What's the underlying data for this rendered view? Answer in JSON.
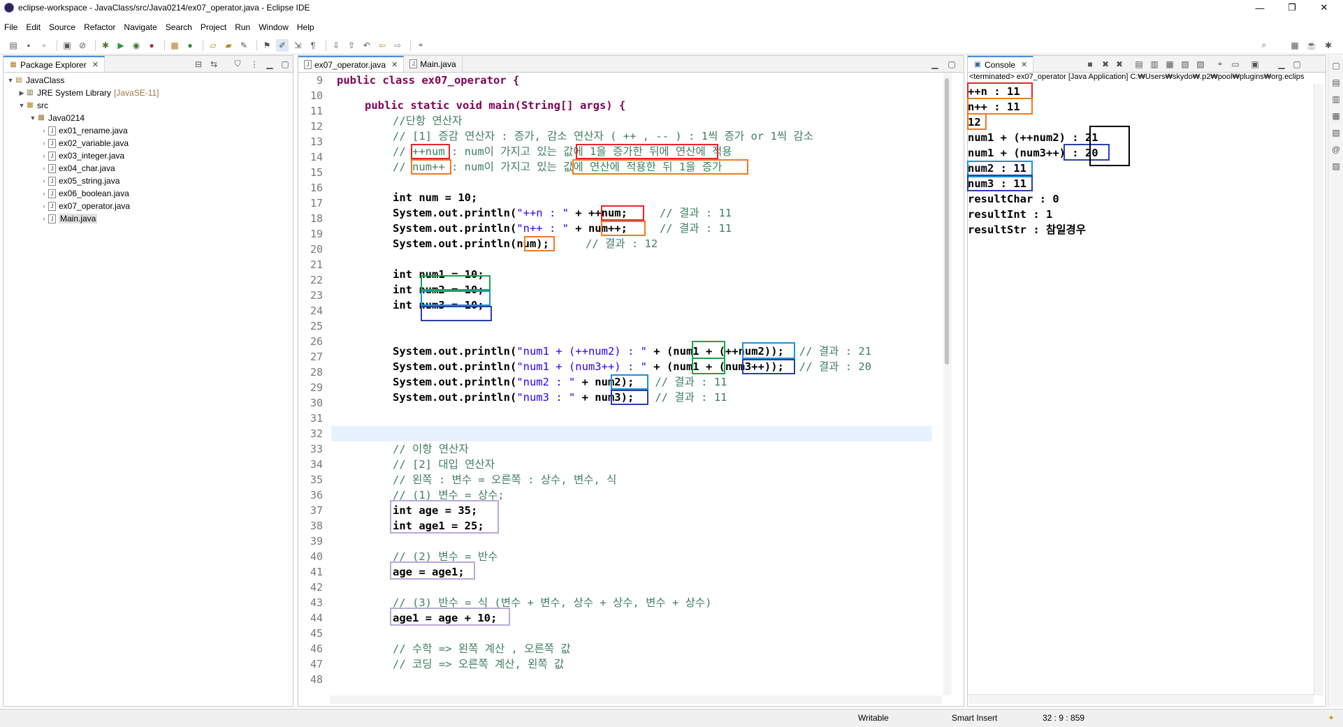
{
  "window": {
    "title": "eclipse-workspace - JavaClass/src/Java0214/ex07_operator.java - Eclipse IDE",
    "minimize": "—",
    "maximize": "❐",
    "close": "✕"
  },
  "menu": [
    "File",
    "Edit",
    "Source",
    "Refactor",
    "Navigate",
    "Search",
    "Project",
    "Run",
    "Window",
    "Help"
  ],
  "package_explorer": {
    "tab": "Package Explorer",
    "nodes": {
      "project": "JavaClass",
      "jre": "JRE System Library",
      "jre_version": "[JavaSE-11]",
      "src": "src",
      "package": "Java0214"
    },
    "files": [
      "ex01_rename.java",
      "ex02_variable.java",
      "ex03_integer.java",
      "ex04_char.java",
      "ex05_string.java",
      "ex06_boolean.java",
      "ex07_operator.java",
      "Main.java"
    ]
  },
  "editor": {
    "tabs": [
      "ex07_operator.java",
      "Main.java"
    ],
    "line_numbers": [
      "9",
      "10",
      "11",
      "12",
      "13",
      "14",
      "15",
      "16",
      "17",
      "18",
      "19",
      "20",
      "21",
      "22",
      "23",
      "24",
      "25",
      "26",
      "27",
      "28",
      "29",
      "30",
      "31",
      "32",
      "33",
      "34",
      "35",
      "36",
      "37",
      "38",
      "39",
      "40",
      "41",
      "42",
      "43",
      "44",
      "45",
      "46",
      "47",
      "48"
    ],
    "lines": {
      "l9": "public class ex07_operator {",
      "l11": "public static void main(String[] args) {",
      "l12": "//단항 연산자",
      "l13": "// [1] 증감 연산자 : 증가, 감소 연산자 ( ++ , -- ) : 1씩 증가 or 1씩 감소",
      "l14": "// ++num : num이 가지고 있는 값에 1을 증가한 뒤에 연산에 적용",
      "l15": "// num++ : num이 가지고 있는 값에 연산에 적용한 뒤 1을 증가",
      "l17": "int num = 10;",
      "l18a": "System.out.println(",
      "l18s": "\"++n : \"",
      "l18b": " + ++num;",
      "l18c": "// 결과 : 11",
      "l19s": "\"n++ : \"",
      "l19b": " + num++;",
      "l19c": "// 결과 : 11",
      "l20b": "num);",
      "l20c": "// 결과 : 12",
      "l22": "int num1 = 10;",
      "l23": "int num2 = 10;",
      "l24": "int num3 = 10;",
      "l27s": "\"num1 + (++num2) : \"",
      "l27b": " + (num1 + (++num2));",
      "l27c": "// 결과 : 21",
      "l28s": "\"num1 + (num3++) : \"",
      "l28b": " + (num1 + (num3++));",
      "l28c": "// 결과 : 20",
      "l29s": "\"num2 : \"",
      "l29b": " + num2);",
      "l29c": "// 결과 : 11",
      "l30s": "\"num3 : \"",
      "l30b": " + num3);",
      "l30c": "// 결과 : 11",
      "l33": "// 이항 연산자",
      "l34": "// [2] 대입 연산자",
      "l35": "// 왼쪽 : 변수 = 오른쪽 : 상수, 변수, 식",
      "l36": "// (1) 변수 = 상수;",
      "l37": "int age = 35;",
      "l38": "int age1 = 25;",
      "l40": "// (2) 변수 = 반수",
      "l41": "age = age1;",
      "l43": "// (3) 반수 = 식 (변수 + 변수, 상수 + 상수, 변수 + 상수)",
      "l44": "age1 = age + 10;",
      "l46": "// 수학 => 왼쪽 계산 , 오른쪽 값",
      "l47": "// 코딩 => 오른쪽 계산, 왼쪽 값"
    }
  },
  "console": {
    "tab": "Console",
    "header": "<terminated> ex07_operator [Java Application] C:₩Users₩skydo₩.p2₩pool₩plugins₩org.eclips",
    "output": [
      "++n : 11",
      "n++ : 11",
      "12",
      "num1 + (++num2) : 21",
      "num1 + (num3++) : 20",
      "num2 : 11",
      "num3 : 11",
      "resultChar : 0",
      "resultInt : 1",
      "resultStr : 참일경우"
    ]
  },
  "status": {
    "writable": "Writable",
    "insert": "Smart Insert",
    "position": "32 : 9 : 859"
  },
  "colors": {
    "red": "#e8262b",
    "orange": "#f07a20",
    "green": "#1aa34a",
    "cyan": "#1e90d8",
    "blue": "#2a3fa8",
    "lavender": "#b9a8dc",
    "black": "#000000",
    "keyword": "#7f0055",
    "comment": "#3f7f5f",
    "string": "#2a00ff"
  }
}
